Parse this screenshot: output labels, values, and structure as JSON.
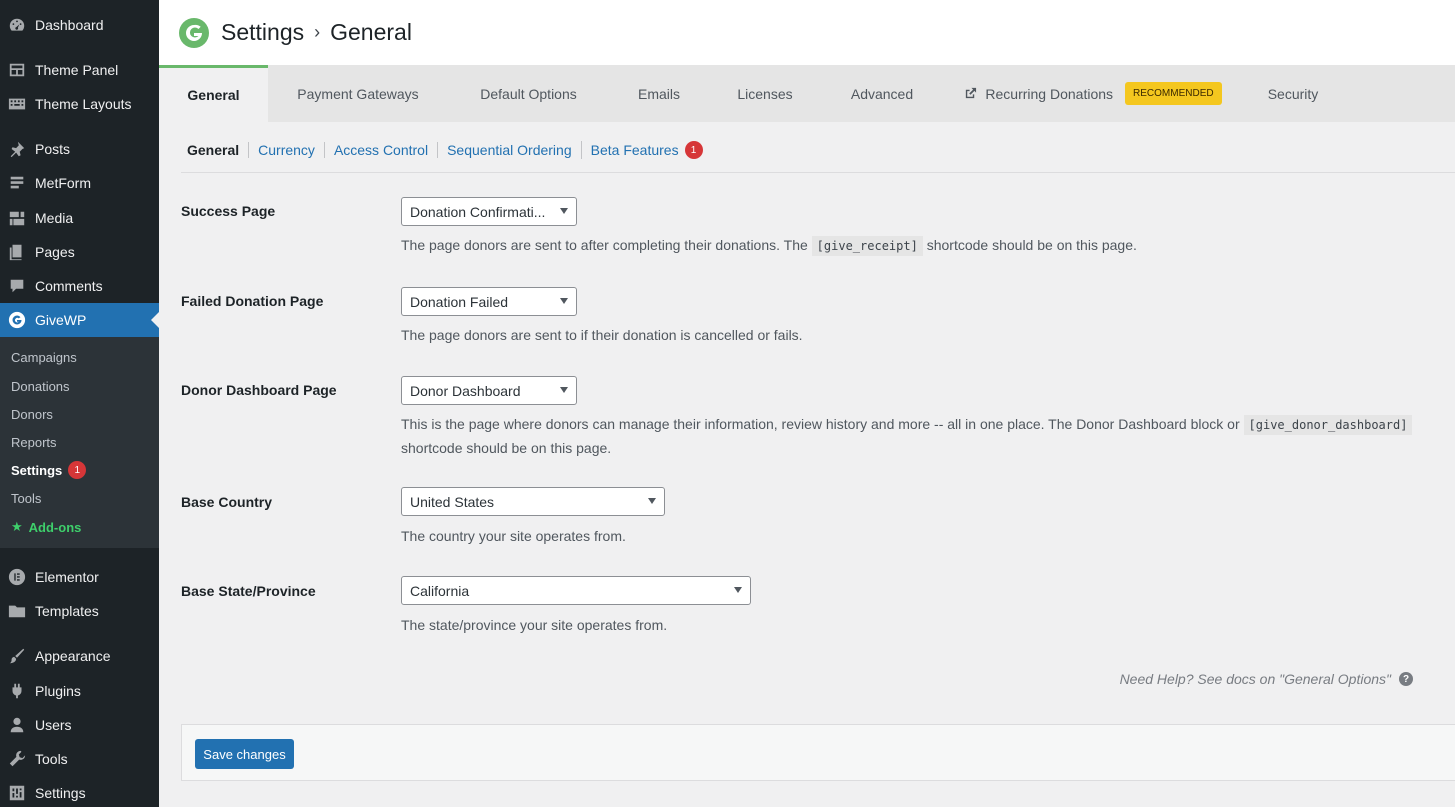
{
  "sidebar": {
    "items": [
      {
        "label": "Dashboard",
        "icon": "dashboard-icon"
      },
      {
        "label": "Theme Panel",
        "icon": "theme-panel-icon"
      },
      {
        "label": "Theme Layouts",
        "icon": "theme-layouts-icon"
      },
      {
        "label": "Posts",
        "icon": "pin-icon"
      },
      {
        "label": "MetForm",
        "icon": "metform-icon"
      },
      {
        "label": "Media",
        "icon": "media-icon"
      },
      {
        "label": "Pages",
        "icon": "pages-icon"
      },
      {
        "label": "Comments",
        "icon": "comments-icon"
      },
      {
        "label": "GiveWP",
        "icon": "givewp-icon",
        "active": true
      },
      {
        "label": "Elementor",
        "icon": "elementor-icon"
      },
      {
        "label": "Templates",
        "icon": "folder-icon"
      },
      {
        "label": "Appearance",
        "icon": "brush-icon"
      },
      {
        "label": "Plugins",
        "icon": "plugin-icon"
      },
      {
        "label": "Users",
        "icon": "user-icon"
      },
      {
        "label": "Tools",
        "icon": "wrench-icon"
      },
      {
        "label": "Settings",
        "icon": "settings-icon"
      }
    ],
    "submenu": [
      {
        "label": "Campaigns"
      },
      {
        "label": "Donations"
      },
      {
        "label": "Donors"
      },
      {
        "label": "Reports"
      },
      {
        "label": "Settings",
        "badge": "1",
        "current": true
      },
      {
        "label": "Tools"
      },
      {
        "label": "Add-ons",
        "icon": "star-icon"
      }
    ]
  },
  "header": {
    "title": "Settings",
    "separator": "›",
    "subtitle": "General",
    "logo_color": "#69b86b"
  },
  "tabs": [
    {
      "label": "General",
      "active": true
    },
    {
      "label": "Payment Gateways"
    },
    {
      "label": "Default Options"
    },
    {
      "label": "Emails"
    },
    {
      "label": "Licenses"
    },
    {
      "label": "Advanced"
    },
    {
      "label": "Recurring Donations",
      "icon": "external-link-icon",
      "tag": "RECOMMENDED"
    },
    {
      "label": "Security"
    }
  ],
  "subtabs": [
    {
      "label": "General"
    },
    {
      "label": "Currency"
    },
    {
      "label": "Access Control"
    },
    {
      "label": "Sequential Ordering"
    },
    {
      "label": "Beta Features",
      "badge": "1"
    }
  ],
  "fields": [
    {
      "label": "Success Page",
      "value": "Donation Confirmati...",
      "desc_before": "The page donors are sent to after completing their donations. The",
      "code": "[give_receipt]",
      "desc_after": "shortcode should be on this page."
    },
    {
      "label": "Failed Donation Page",
      "value": "Donation Failed",
      "desc_before": "The page donors are sent to if their donation is cancelled or fails."
    },
    {
      "label": "Donor Dashboard Page",
      "value": "Donor Dashboard",
      "desc_before": "This is the page where donors can manage their information, review history and more -- all in one place. The Donor Dashboard block or",
      "code": "[give_donor_dashboard]",
      "desc_after": "shortcode should be on this page."
    },
    {
      "label": "Base Country",
      "value": "United States",
      "desc_before": "The country your site operates from."
    },
    {
      "label": "Base State/Province",
      "value": "California",
      "desc_before": "The state/province your site operates from."
    }
  ],
  "help": {
    "text": "Need Help? See docs on \"General Options\"",
    "icon": "help-icon"
  },
  "save_label": "Save changes",
  "colors": {
    "sidebar_bg": "#1d2327",
    "accent": "#2271b1",
    "recommended": "#f4c71f",
    "badge": "#d63638"
  }
}
